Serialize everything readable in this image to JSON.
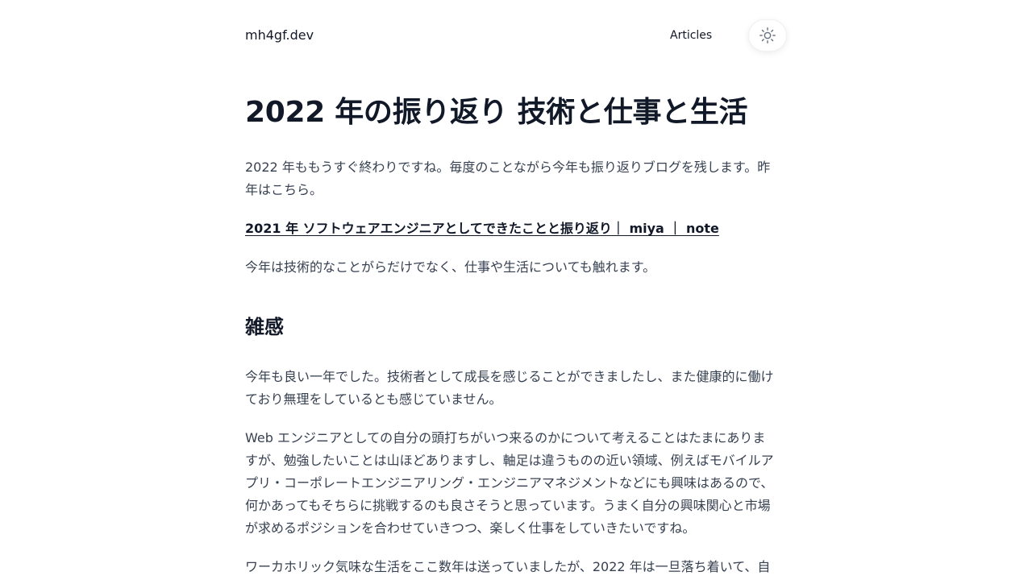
{
  "header": {
    "site_title": "mh4gf.dev",
    "nav": {
      "articles_label": "Articles"
    },
    "theme_toggle": {
      "icon": "sun-icon"
    }
  },
  "article": {
    "title": "2022 年の振り返り 技術と仕事と生活",
    "intro": "2022 年ももうすぐ終わりですね。毎度のことながら今年も振り返りブログを残します。昨年はこちら。",
    "link_text": "2021 年 ソフトウェアエンジニアとしてできたことと振り返り｜ miya ｜ note",
    "tech_life_note": "今年は技術的なことがらだけでなく、仕事や生活についても触れます。",
    "sections": [
      {
        "heading": "雑感",
        "paragraphs": [
          "今年も良い一年でした。技術者として成長を感じることができましたし、また健康的に働けており無理をしているとも感じていません。",
          "Web エンジニアとしての自分の頭打ちがいつ来るのかについて考えることはたまにありますが、勉強したいことは山ほどありますし、軸足は違うものの近い領域、例えばモバイルアプリ・コーポレートエンジニアリング・エンジニアマネジメントなどにも興味はあるので、何かあってもそちらに挑戦するのも良さそうと思っています。うまく自分の興味関心と市場が求めるポジションを合わせていきつつ、楽しく仕事をしていきたいですね。",
          "ワーカホリック気味な生活をここ数年は送っていましたが、2022 年は一旦落ち着いて、自"
        ]
      }
    ]
  },
  "colors": {
    "heading": "#111827",
    "body_text": "#374151",
    "background": "#ffffff"
  }
}
